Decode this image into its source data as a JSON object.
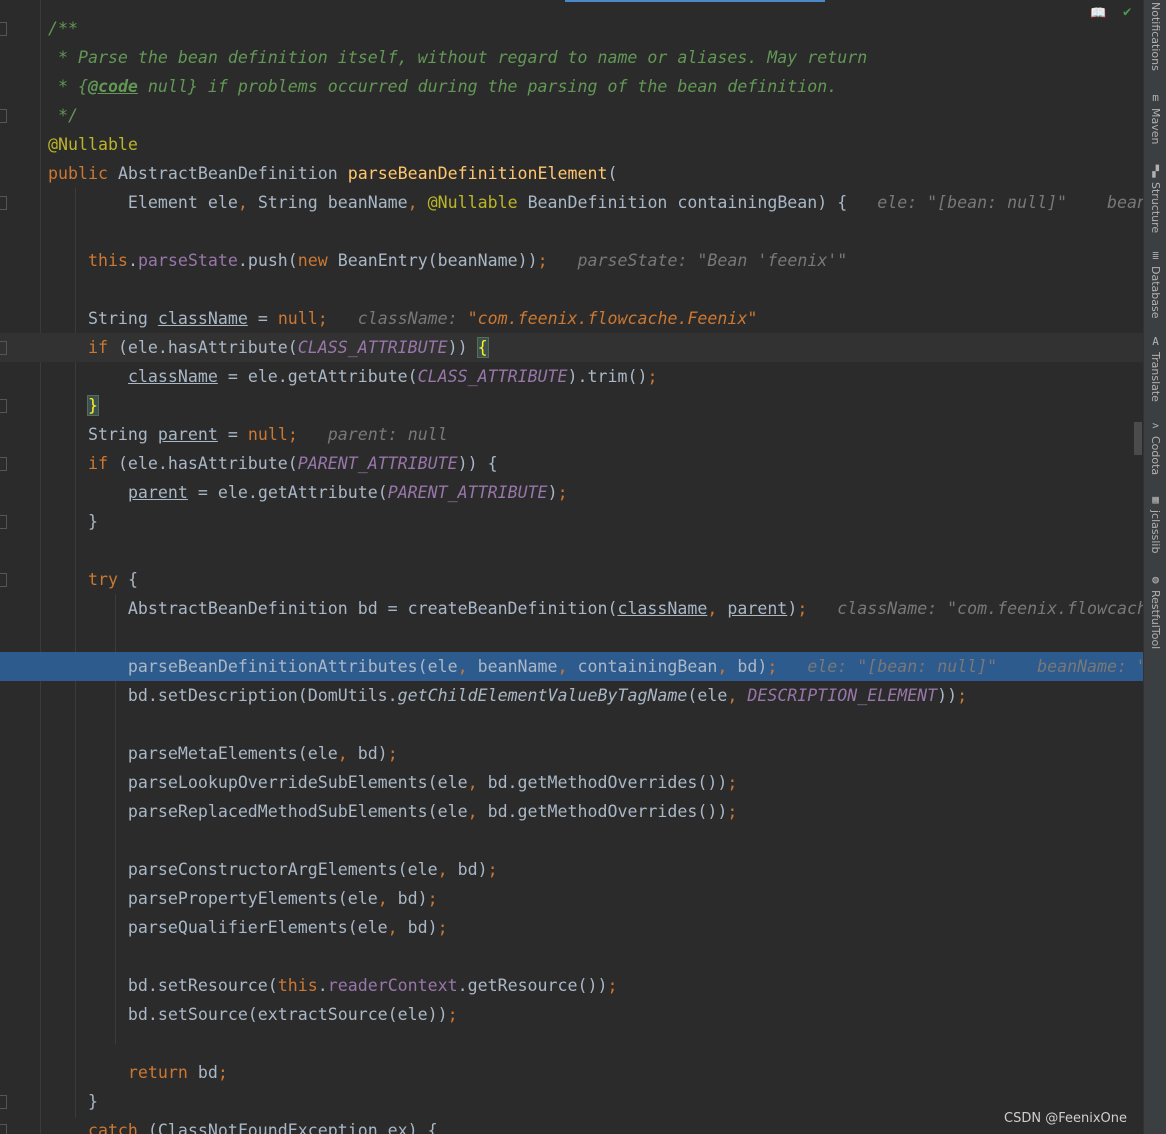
{
  "editor": {
    "current_line": 11,
    "execution_line": 22,
    "lines": [
      [
        [
          "c",
          "/**"
        ]
      ],
      [
        [
          "c",
          " * Parse the bean definition itself, without regard to name or aliases. May return"
        ]
      ],
      [
        [
          "c",
          " * {"
        ],
        [
          "cd",
          "@code"
        ],
        [
          "c",
          " null} if problems occurred during the parsing of the bean definition."
        ]
      ],
      [
        [
          "c",
          " */"
        ]
      ],
      [
        [
          "a",
          "@Nullable"
        ]
      ],
      [
        [
          "k",
          "public "
        ],
        [
          "t",
          "AbstractBeanDefinition "
        ],
        [
          "m",
          "parseBeanDefinitionElement"
        ],
        [
          "t",
          "("
        ]
      ],
      [
        [
          "t",
          "        Element ele"
        ],
        [
          "p",
          ", "
        ],
        [
          "t",
          "String beanName"
        ],
        [
          "p",
          ", "
        ],
        [
          "a",
          "@Nullable "
        ],
        [
          "t",
          "BeanDefinition containingBean) {   "
        ],
        [
          "h",
          "ele: \"[bean: null]\"    beanName: \"feenix\""
        ]
      ],
      [],
      [
        [
          "k",
          "    this"
        ],
        [
          "t",
          "."
        ],
        [
          "f",
          "parseState"
        ],
        [
          "t",
          ".push("
        ],
        [
          "k",
          "new "
        ],
        [
          "t",
          "BeanEntry(beanName))"
        ],
        [
          "p",
          ";"
        ],
        [
          "h",
          "   parseState: \"Bean 'feenix'\""
        ]
      ],
      [],
      [
        [
          "t",
          "    String "
        ],
        [
          "u",
          "className"
        ],
        [
          "t",
          " = "
        ],
        [
          "k",
          "null"
        ],
        [
          "p",
          ";"
        ],
        [
          "h",
          "   className: "
        ],
        [
          "hs",
          "\"com.feenix.flowcache.Feenix\""
        ]
      ],
      [
        [
          "k",
          "    if "
        ],
        [
          "t",
          "(ele.hasAttribute("
        ],
        [
          "fi",
          "CLASS_ATTRIBUTE"
        ],
        [
          "t",
          ")) "
        ],
        [
          "br",
          "{"
        ]
      ],
      [
        [
          "t",
          "        "
        ],
        [
          "u",
          "className"
        ],
        [
          "t",
          " = ele.getAttribute("
        ],
        [
          "fi",
          "CLASS_ATTRIBUTE"
        ],
        [
          "t",
          ").trim()"
        ],
        [
          "p",
          ";"
        ]
      ],
      [
        [
          "t",
          "    "
        ],
        [
          "br",
          "}"
        ]
      ],
      [
        [
          "t",
          "    String "
        ],
        [
          "u",
          "parent"
        ],
        [
          "t",
          " = "
        ],
        [
          "k",
          "null"
        ],
        [
          "p",
          ";"
        ],
        [
          "h",
          "   parent: null"
        ]
      ],
      [
        [
          "k",
          "    if "
        ],
        [
          "t",
          "(ele.hasAttribute("
        ],
        [
          "fi",
          "PARENT_ATTRIBUTE"
        ],
        [
          "t",
          ")) {"
        ]
      ],
      [
        [
          "t",
          "        "
        ],
        [
          "u",
          "parent"
        ],
        [
          "t",
          " = ele.getAttribute("
        ],
        [
          "fi",
          "PARENT_ATTRIBUTE"
        ],
        [
          "t",
          ")"
        ],
        [
          "p",
          ";"
        ]
      ],
      [
        [
          "t",
          "    }"
        ]
      ],
      [],
      [
        [
          "k",
          "    try "
        ],
        [
          "t",
          "{"
        ]
      ],
      [
        [
          "t",
          "        AbstractBeanDefinition bd = createBeanDefinition("
        ],
        [
          "u",
          "className"
        ],
        [
          "p",
          ", "
        ],
        [
          "u",
          "parent"
        ],
        [
          "t",
          ")"
        ],
        [
          "p",
          ";"
        ],
        [
          "h",
          "   className: \"com.feenix.flowcache.Feenix\""
        ]
      ],
      [],
      [
        [
          "t",
          "        parseBeanDefinitionAttributes(ele"
        ],
        [
          "p",
          ", "
        ],
        [
          "t",
          "beanName"
        ],
        [
          "p",
          ", "
        ],
        [
          "t",
          "containingBean"
        ],
        [
          "p",
          ", "
        ],
        [
          "t",
          "bd)"
        ],
        [
          "p",
          ";"
        ],
        [
          "h",
          "   ele: \"[bean: null]\"    beanName: \"feenix\""
        ]
      ],
      [
        [
          "t",
          "        bd.setDescription(DomUtils."
        ],
        [
          "s",
          "getChildElementValueByTagName"
        ],
        [
          "t",
          "(ele"
        ],
        [
          "p",
          ", "
        ],
        [
          "fi",
          "DESCRIPTION_ELEMENT"
        ],
        [
          "t",
          "))"
        ],
        [
          "p",
          ";"
        ]
      ],
      [],
      [
        [
          "t",
          "        parseMetaElements(ele"
        ],
        [
          "p",
          ", "
        ],
        [
          "t",
          "bd)"
        ],
        [
          "p",
          ";"
        ]
      ],
      [
        [
          "t",
          "        parseLookupOverrideSubElements(ele"
        ],
        [
          "p",
          ", "
        ],
        [
          "t",
          "bd.getMethodOverrides())"
        ],
        [
          "p",
          ";"
        ]
      ],
      [
        [
          "t",
          "        parseReplacedMethodSubElements(ele"
        ],
        [
          "p",
          ", "
        ],
        [
          "t",
          "bd.getMethodOverrides())"
        ],
        [
          "p",
          ";"
        ]
      ],
      [],
      [
        [
          "t",
          "        parseConstructorArgElements(ele"
        ],
        [
          "p",
          ", "
        ],
        [
          "t",
          "bd)"
        ],
        [
          "p",
          ";"
        ]
      ],
      [
        [
          "t",
          "        parsePropertyElements(ele"
        ],
        [
          "p",
          ", "
        ],
        [
          "t",
          "bd)"
        ],
        [
          "p",
          ";"
        ]
      ],
      [
        [
          "t",
          "        parseQualifierElements(ele"
        ],
        [
          "p",
          ", "
        ],
        [
          "t",
          "bd)"
        ],
        [
          "p",
          ";"
        ]
      ],
      [],
      [
        [
          "t",
          "        bd.setResource("
        ],
        [
          "k",
          "this"
        ],
        [
          "t",
          "."
        ],
        [
          "f",
          "readerContext"
        ],
        [
          "t",
          ".getResource())"
        ],
        [
          "p",
          ";"
        ]
      ],
      [
        [
          "t",
          "        bd.setSource(extractSource(ele))"
        ],
        [
          "p",
          ";"
        ]
      ],
      [],
      [
        [
          "k",
          "        return "
        ],
        [
          "t",
          "bd"
        ],
        [
          "p",
          ";"
        ]
      ],
      [
        [
          "t",
          "    }"
        ]
      ],
      [
        [
          "k",
          "    catch "
        ],
        [
          "t",
          "(ClassNotFoundException ex) {"
        ]
      ]
    ]
  },
  "toolbar": {
    "reader_mode_icon": "book-icon",
    "status_icon": "check-icon"
  },
  "sidebar": {
    "items": [
      {
        "label": "Notifications",
        "icon": ""
      },
      {
        "label": "Maven",
        "icon": "m"
      },
      {
        "label": "Structure",
        "icon": "▞"
      },
      {
        "label": "Database",
        "icon": "≣"
      },
      {
        "label": "Translate",
        "icon": "A"
      },
      {
        "label": "Codota",
        "icon": ">"
      },
      {
        "label": "jclasslib",
        "icon": "▦"
      },
      {
        "label": "RestfulTool",
        "icon": "◍"
      }
    ]
  },
  "watermark": "CSDN @FeenixOne",
  "colors": {
    "background": "#2b2b2b",
    "keyword": "#cc7832",
    "comment": "#629755",
    "annotation": "#bbb529",
    "execution_line": "#2d5b8e"
  }
}
